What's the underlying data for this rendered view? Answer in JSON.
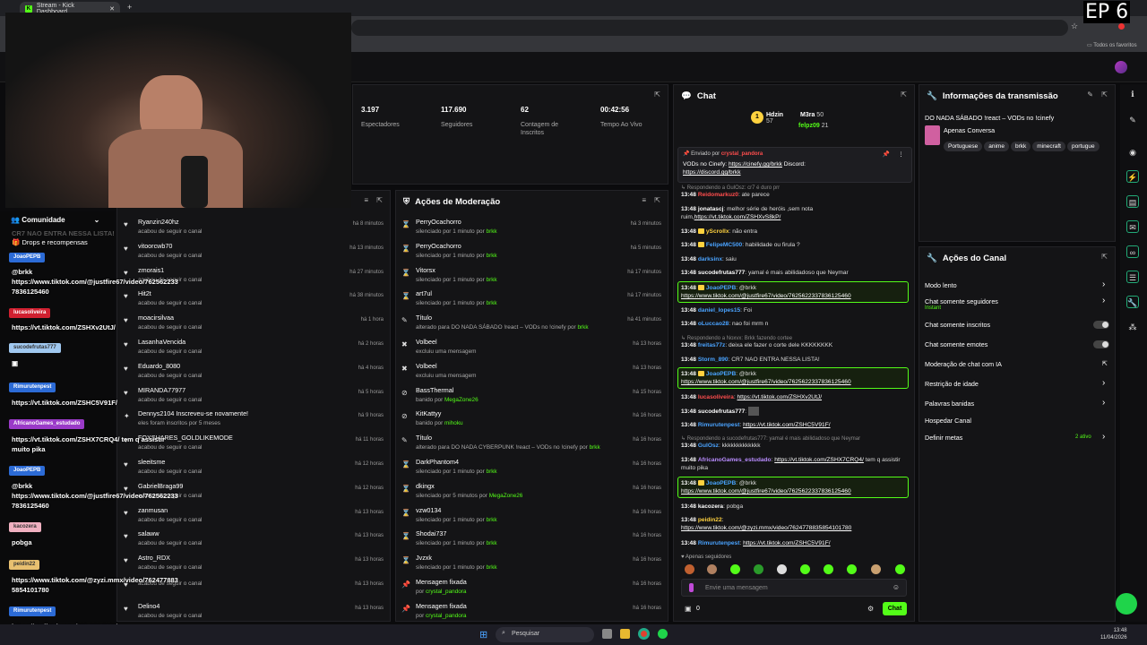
{
  "browser": {
    "tab_title": "Stream - Kick Dashboard",
    "favorites_label": "Todos os favoritos"
  },
  "episode_label": "EP 6",
  "stats": [
    {
      "value": "3.197",
      "label": "Espectadores"
    },
    {
      "value": "117.690",
      "label": "Seguidores"
    },
    {
      "value": "62",
      "label": "Contagem de Inscritos"
    },
    {
      "value": "00:42:56",
      "label": "Tempo Ao Vivo"
    }
  ],
  "community": {
    "title": "Comunidade",
    "pinned_overlay": "CR7 NAO ENTRA NESSA LISTA!",
    "drops_label": "Drops e recompensas"
  },
  "activity": [
    {
      "name": "Ryanzin240hz",
      "sub": "acabou de seguir o canal",
      "time": "há 8 minutos"
    },
    {
      "name": "vitoorcwb70",
      "sub": "acabou de seguir o canal",
      "time": "há 13 minutos"
    },
    {
      "name": "zmorais1",
      "sub": "acabou de seguir o canal",
      "time": "há 27 minutos"
    },
    {
      "name": "Hit2t",
      "sub": "acabou de seguir o canal",
      "time": "há 38 minutos"
    },
    {
      "name": "moacirsilvaa",
      "sub": "acabou de seguir o canal",
      "time": "há 1 hora"
    },
    {
      "name": "LasanhaVencida",
      "sub": "acabou de seguir o canal",
      "time": "há 2 horas"
    },
    {
      "name": "Eduardo_8080",
      "sub": "acabou de seguir o canal",
      "time": "há 4 horas"
    },
    {
      "name": "MIRANDA77977",
      "sub": "acabou de seguir o canal",
      "time": "há 5 horas"
    },
    {
      "name": "Dennys2104 Inscreveu-se novamente!",
      "sub": "eles foram inscritos por 5 meses",
      "time": "há 9 horas"
    },
    {
      "name": "FOXSHARES_GOLDLIKEMODE",
      "sub": "acabou de seguir o canal",
      "time": "há 11 horas"
    },
    {
      "name": "sleeitsme",
      "sub": "acabou de seguir o canal",
      "time": "há 12 horas"
    },
    {
      "name": "GabrielBraga99",
      "sub": "acabou de seguir o canal",
      "time": "há 12 horas"
    },
    {
      "name": "zanmusan",
      "sub": "acabou de seguir o canal",
      "time": "há 13 horas"
    },
    {
      "name": "salaww",
      "sub": "acabou de seguir o canal",
      "time": "há 13 horas"
    },
    {
      "name": "Astro_RDX",
      "sub": "acabou de seguir o canal",
      "time": "há 13 horas"
    },
    {
      "name": "",
      "sub": "acabou de seguir o canal",
      "time": "há 13 horas"
    },
    {
      "name": "Delino4",
      "sub": "acabou de seguir o canal",
      "time": "há 13 horas"
    }
  ],
  "moderation": {
    "title": "Ações de Moderação",
    "items": [
      {
        "icon": "⌛",
        "name": "PerryOcachorro",
        "sub": "silenciado por 1 minuto por ",
        "by": "brkk",
        "time": "há 3 minutos"
      },
      {
        "icon": "⌛",
        "name": "PerryOcachorro",
        "sub": "silenciado por 1 minuto por ",
        "by": "brkk",
        "time": "há 5 minutos"
      },
      {
        "icon": "⌛",
        "name": "Vitorsx",
        "sub": "silenciado por 1 minuto por ",
        "by": "brkk",
        "time": "há 17 minutos"
      },
      {
        "icon": "⌛",
        "name": "art7ul",
        "sub": "silenciado por 1 minuto por ",
        "by": "brkk",
        "time": "há 17 minutos"
      },
      {
        "icon": "✎",
        "name": "Título",
        "sub": "alterado para DO NADA SÁBADO !react – VODs no !cinefy por ",
        "by": "brkk",
        "time": "há 41 minutos"
      },
      {
        "icon": "✖",
        "name": "Volbeel",
        "sub": "excluiu uma mensagem",
        "by": "",
        "time": "há 13 horas"
      },
      {
        "icon": "✖",
        "name": "Volbeel",
        "sub": "excluiu uma mensagem",
        "by": "",
        "time": "há 13 horas"
      },
      {
        "icon": "⊘",
        "name": "BassThermal",
        "sub": "banido por ",
        "by": "MegaZone26",
        "time": "há 15 horas"
      },
      {
        "icon": "⊘",
        "name": "KitKattyy",
        "sub": "banido por ",
        "by": "mihoku",
        "time": "há 16 horas"
      },
      {
        "icon": "✎",
        "name": "Título",
        "sub": "alterado para DO NADA CYBERPUNK !react – VODs no !cinefy por ",
        "by": "brkk",
        "time": "há 16 horas"
      },
      {
        "icon": "⌛",
        "name": "DarkPhantom4",
        "sub": "silenciado por 1 minuto por ",
        "by": "brkk",
        "time": "há 16 horas"
      },
      {
        "icon": "⌛",
        "name": "dkingx",
        "sub": "silenciado por 5 minutos por ",
        "by": "MegaZone26",
        "time": "há 16 horas"
      },
      {
        "icon": "⌛",
        "name": "vzw0134",
        "sub": "silenciado por 1 minuto por ",
        "by": "brkk",
        "time": "há 16 horas"
      },
      {
        "icon": "⌛",
        "name": "Shodai737",
        "sub": "silenciado por 1 minuto por ",
        "by": "brkk",
        "time": "há 16 horas"
      },
      {
        "icon": "⌛",
        "name": "Jvzxk",
        "sub": "silenciado por 1 minuto por ",
        "by": "brkk",
        "time": "há 16 horas"
      },
      {
        "icon": "📌",
        "name": "Mensagem fixada",
        "sub": "por ",
        "by": "crystal_pandora",
        "time": "há 16 horas"
      },
      {
        "icon": "📌",
        "name": "Mensagem fixada",
        "sub": "por ",
        "by": "crystal_pandora",
        "time": "há 16 horas"
      }
    ]
  },
  "chat": {
    "title": "Chat",
    "leaders": [
      {
        "name": "Hdzin",
        "n": "57"
      },
      {
        "name": "M3ra",
        "n": "50"
      },
      {
        "name": "felpz09",
        "n": "21"
      }
    ],
    "pinned_by": "Enviado por",
    "pinned_user": "crystal_pandora",
    "pinned_text": "VODs no Cinefy: ",
    "pinned_link": "https://cinefy.gg/brkk",
    "pinned_text2": " Discord: ",
    "pinned_link2": "https://discord.gg/brkk",
    "followers_only": "Apenas seguidores",
    "input_placeholder": "Envie uma mensagem",
    "send_label": "Chat",
    "points": "0"
  },
  "info": {
    "title": "Informações da transmissão",
    "stream_title": "DO NADA SÁBADO !react – VODs no !cinefy",
    "category": "Apenas Conversa",
    "tags": [
      "Portuguese",
      "anime",
      "brkk",
      "minecraft",
      "portugue"
    ]
  },
  "channel_actions": {
    "title": "Ações do Canal",
    "items": [
      {
        "label": "Modo lento",
        "sub": "",
        "control": "chevron"
      },
      {
        "label": "Chat somente seguidores",
        "sub": "Instant",
        "control": "chevron"
      },
      {
        "label": "Chat somente inscritos",
        "sub": "",
        "control": "toggle"
      },
      {
        "label": "Chat somente emotes",
        "sub": "",
        "control": "toggle"
      },
      {
        "label": "Moderação de chat com IA",
        "sub": "",
        "control": "external"
      },
      {
        "label": "Restrição de idade",
        "sub": "",
        "control": "chevron"
      },
      {
        "label": "Palavras banidas",
        "sub": "",
        "control": "chevron"
      },
      {
        "label": "Hospedar Canal",
        "sub": "",
        "control": "none"
      },
      {
        "label": "Definir metas",
        "sub": "2 ativo",
        "control": "chevron"
      }
    ]
  },
  "taskbar": {
    "search": "Pesquisar",
    "time": "13:48",
    "date": "11/04/2026"
  }
}
